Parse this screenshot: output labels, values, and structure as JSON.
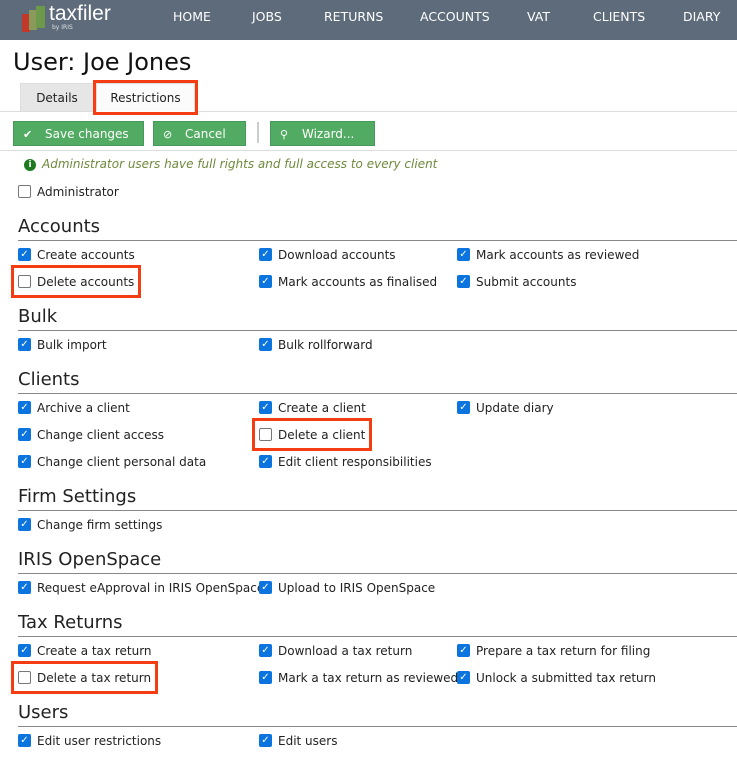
{
  "app": {
    "name": "taxfiler",
    "sub": "by IRIS"
  },
  "nav": [
    "HOME",
    "JOBS",
    "RETURNS",
    "ACCOUNTS",
    "VAT",
    "CLIENTS",
    "DIARY"
  ],
  "title": "User: Joe Jones",
  "tabs": [
    {
      "label": "Details",
      "active": false
    },
    {
      "label": "Restrictions",
      "active": true
    }
  ],
  "toolbar": {
    "save": "Save changes",
    "cancel": "Cancel",
    "wizard": "Wizard..."
  },
  "info": "Administrator users have full rights and full access to every client",
  "administrator": {
    "label": "Administrator",
    "checked": false
  },
  "colors": {
    "nav": "#5d6b7a",
    "button": "#52ab62",
    "checkbox": "#0b74de",
    "highlight": "#f43d12"
  },
  "sections": [
    {
      "title": "Accounts",
      "rows": [
        [
          {
            "label": "Create accounts",
            "checked": true
          },
          {
            "label": "Download accounts",
            "checked": true
          },
          {
            "label": "Mark accounts as reviewed",
            "checked": true
          }
        ],
        [
          {
            "label": "Delete accounts",
            "checked": false,
            "highlighted": true
          },
          {
            "label": "Mark accounts as finalised",
            "checked": true
          },
          {
            "label": "Submit accounts",
            "checked": true
          }
        ]
      ]
    },
    {
      "title": "Bulk",
      "rows": [
        [
          {
            "label": "Bulk import",
            "checked": true
          },
          {
            "label": "Bulk rollforward",
            "checked": true
          }
        ]
      ]
    },
    {
      "title": "Clients",
      "rows": [
        [
          {
            "label": "Archive a client",
            "checked": true
          },
          {
            "label": "Create a client",
            "checked": true
          },
          {
            "label": "Update diary",
            "checked": true
          }
        ],
        [
          {
            "label": "Change client access",
            "checked": true
          },
          {
            "label": "Delete a client",
            "checked": false,
            "highlighted": true
          }
        ],
        [
          {
            "label": "Change client personal data",
            "checked": true
          },
          {
            "label": "Edit client responsibilities",
            "checked": true
          }
        ]
      ]
    },
    {
      "title": "Firm Settings",
      "rows": [
        [
          {
            "label": "Change firm settings",
            "checked": true
          }
        ]
      ]
    },
    {
      "title": "IRIS OpenSpace",
      "rows": [
        [
          {
            "label": "Request eApproval in IRIS OpenSpace",
            "checked": true
          },
          {
            "label": "Upload to IRIS OpenSpace",
            "checked": true
          }
        ]
      ]
    },
    {
      "title": "Tax Returns",
      "rows": [
        [
          {
            "label": "Create a tax return",
            "checked": true
          },
          {
            "label": "Download a tax return",
            "checked": true
          },
          {
            "label": "Prepare a tax return for filing",
            "checked": true
          }
        ],
        [
          {
            "label": "Delete a tax return",
            "checked": false,
            "highlighted": true
          },
          {
            "label": "Mark a tax return as reviewed",
            "checked": true
          },
          {
            "label": "Unlock a submitted tax return",
            "checked": true
          }
        ]
      ]
    },
    {
      "title": "Users",
      "rows": [
        [
          {
            "label": "Edit user restrictions",
            "checked": true
          },
          {
            "label": "Edit users",
            "checked": true
          }
        ]
      ]
    }
  ]
}
